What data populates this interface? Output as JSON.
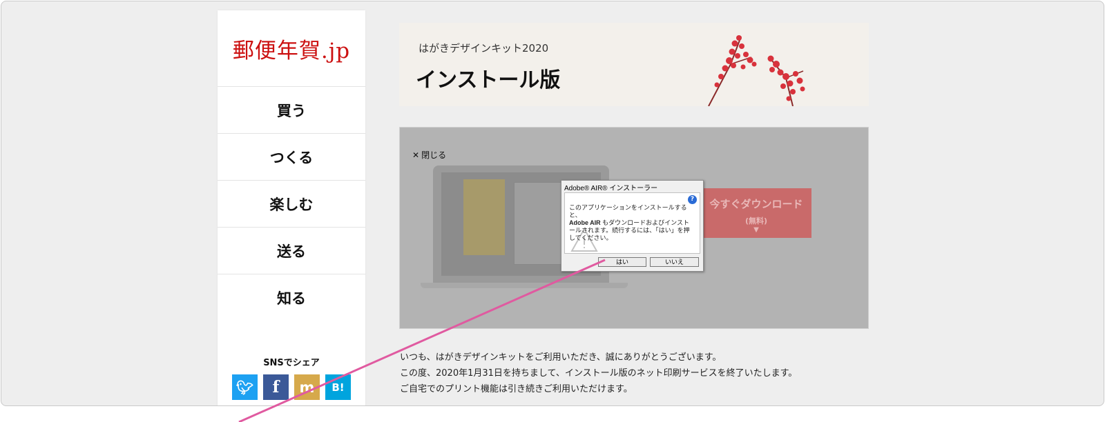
{
  "logo": "郵便年賀.jp",
  "nav": [
    "買う",
    "つくる",
    "楽しむ",
    "送る",
    "知る"
  ],
  "share": {
    "title": "SNSでシェア",
    "icons": [
      {
        "name": "twitter-icon",
        "glyph": "🐦︎",
        "color": "#1da1f2"
      },
      {
        "name": "facebook-icon",
        "glyph": "f",
        "color": "#3b5998"
      },
      {
        "name": "mixi-icon",
        "glyph": "m",
        "color": "#d6a94b"
      },
      {
        "name": "hatena-bookmark-icon",
        "glyph": "B!",
        "color": "#00a4de"
      }
    ]
  },
  "banner": {
    "subtitle": "はがきデザインキット2020",
    "title": "インストール版"
  },
  "video": {
    "close_label": "閉じる",
    "download_label": "今すぐダウンロード",
    "download_sub": "(無料)"
  },
  "dialog": {
    "title": "Adobe® AIR® インストーラー",
    "text_line1": "このアプリケーションをインストールすると、",
    "text_bold": "Adobe AIR",
    "text_line2": " もダウンロードおよびインストールされます。続行するには、「はい」を押してください。",
    "yes_label": "はい",
    "no_label": "いいえ"
  },
  "notice": [
    "いつも、はがきデザインキットをご利用いただき、誠にありがとうございます。",
    "この度、2020年1月31日を持ちまして、インストール版のネット印刷サービスを終了いたします。",
    "ご自宅でのプリント機能は引き続きご利用いただけます。"
  ],
  "colors": {
    "logo": "#cc1111",
    "accent_pointer": "#e05aa0",
    "dim_overlay": "#b3b3b3"
  }
}
